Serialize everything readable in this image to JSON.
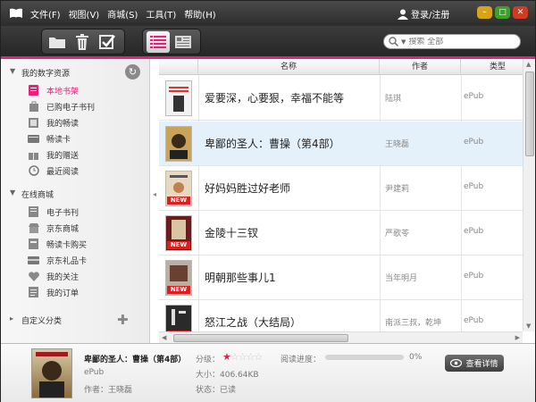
{
  "menu": {
    "file": "文件(F)",
    "view": "视图(V)",
    "store": "商城(S)",
    "tools": "工具(T)",
    "help": "帮助(H)"
  },
  "login": "登录/注册",
  "search": {
    "placeholder": "搜索 全部"
  },
  "sidebar": {
    "section_mine": "我的数字资源",
    "mine_items": [
      {
        "label": "本地书架",
        "icon": "shelf-icon"
      },
      {
        "label": "已购电子书刊",
        "icon": "bag-icon"
      },
      {
        "label": "我的畅读",
        "icon": "book-icon"
      },
      {
        "label": "畅读卡",
        "icon": "card-icon"
      },
      {
        "label": "我的赠送",
        "icon": "gift-icon"
      },
      {
        "label": "最近阅读",
        "icon": "clock-icon"
      }
    ],
    "section_store": "在线商城",
    "store_items": [
      {
        "label": "电子书刊",
        "icon": "ebook-icon"
      },
      {
        "label": "京东商城",
        "icon": "store-icon"
      },
      {
        "label": "畅读卡购买",
        "icon": "card-buy-icon"
      },
      {
        "label": "京东礼品卡",
        "icon": "giftcard-icon"
      },
      {
        "label": "我的关注",
        "icon": "heart-icon"
      },
      {
        "label": "我的订单",
        "icon": "order-icon"
      }
    ],
    "section_custom": "自定义分类"
  },
  "columns": {
    "name": "名称",
    "author": "作者",
    "type": "类型"
  },
  "books": [
    {
      "title": "爱要深，心要狠，幸福不能等",
      "author": "陆琪",
      "type": "ePub",
      "new": false,
      "cover": "#f2f2f2"
    },
    {
      "title": "卑鄙的圣人：曹操（第4部）",
      "author": "王晓磊",
      "type": "ePub",
      "new": false,
      "cover": "#c9a35a"
    },
    {
      "title": "好妈妈胜过好老师",
      "author": "尹建莉",
      "type": "ePub",
      "new": true,
      "cover": "#e8d8c0"
    },
    {
      "title": "金陵十三钗",
      "author": "严歌苓",
      "type": "ePub",
      "new": true,
      "cover": "#6b1d1d"
    },
    {
      "title": "明朝那些事儿1",
      "author": "当年明月",
      "type": "ePub",
      "new": true,
      "cover": "#b8b0a4"
    },
    {
      "title": "怒江之战（大结局）",
      "author": "南派三叔，乾坤",
      "type": "ePub",
      "new": true,
      "cover": "#2a2a2a"
    }
  ],
  "detail": {
    "title": "卑鄙的圣人：曹操（第4部）",
    "format": "ePub",
    "author_line": "作者：王晓磊",
    "rating_label": "分级：",
    "size_line": "大小：406.64KB",
    "status_line": "状态：已读",
    "progress_label": "阅读进度：",
    "progress_value": "0%",
    "progress_fraction": 0,
    "rating": 1,
    "view_button": "查看详情"
  },
  "colors": {
    "accent": "#e8207a",
    "selected_row": "#e4f1fb"
  }
}
